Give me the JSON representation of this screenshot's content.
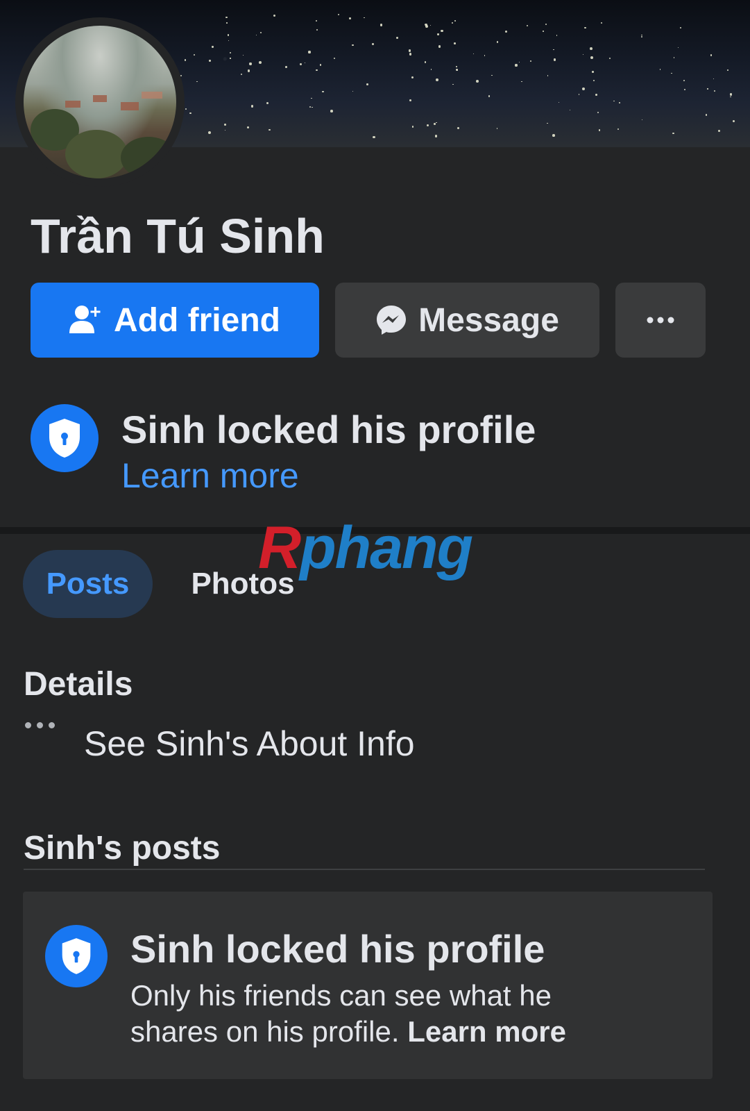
{
  "profile": {
    "name": "Trần Tú Sinh"
  },
  "actions": {
    "add_friend_label": "Add friend",
    "message_label": "Message",
    "more_icon": "more-horizontal-icon"
  },
  "locked_banner": {
    "title": "Sinh locked his profile",
    "link": "Learn more"
  },
  "watermark": {
    "part1": "R",
    "part2": "phang"
  },
  "tabs": [
    {
      "label": "Posts",
      "active": true
    },
    {
      "label": "Photos",
      "active": false
    }
  ],
  "details": {
    "heading": "Details",
    "about_label": "See Sinh's About Info"
  },
  "posts": {
    "heading": "Sinh's posts",
    "card": {
      "title": "Sinh locked his profile",
      "description": "Only his friends can see what he shares on his profile.",
      "link": "Learn more"
    }
  },
  "colors": {
    "background": "#242526",
    "primary": "#1877f2",
    "link": "#4599ff",
    "secondary_button": "#3a3b3c",
    "text": "#e4e6eb"
  }
}
